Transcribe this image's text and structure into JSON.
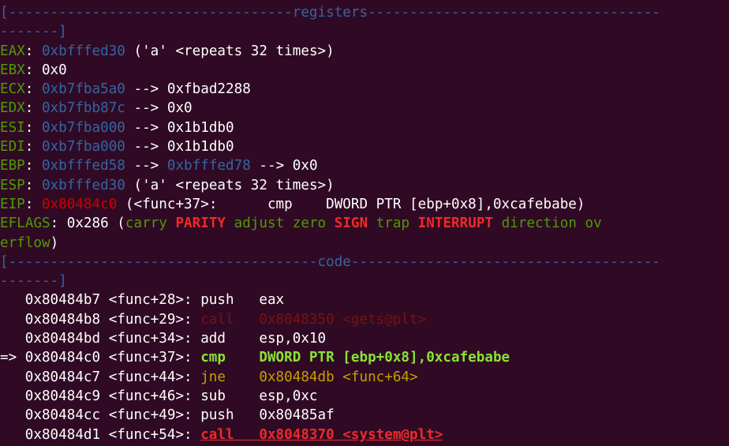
{
  "colors": {
    "background": "#300a24",
    "default": "#ffffff",
    "green": "#4e9a06",
    "blue": "#3465a4",
    "red": "#cc0000",
    "yellow": "#c4a000",
    "bright_green": "#8ae234",
    "bright_red": "#ef2929"
  },
  "lines": [
    [
      {
        "t": "[----------------------------------",
        "c": "blue"
      },
      {
        "t": "registers",
        "c": "blue"
      },
      {
        "t": "-----------------------------------",
        "c": "blue"
      }
    ],
    [
      {
        "t": "-------]",
        "c": "blue"
      }
    ],
    [
      {
        "t": "EAX",
        "c": "green"
      },
      {
        "t": ": ",
        "c": "default"
      },
      {
        "t": "0xbfffed30",
        "c": "blue"
      },
      {
        "t": " ('a' <repeats 32 times>)",
        "c": "default"
      }
    ],
    [
      {
        "t": "EBX",
        "c": "green"
      },
      {
        "t": ": 0x0",
        "c": "default"
      }
    ],
    [
      {
        "t": "ECX",
        "c": "green"
      },
      {
        "t": ": ",
        "c": "default"
      },
      {
        "t": "0xb7fba5a0",
        "c": "blue"
      },
      {
        "t": " --> 0xfbad2288",
        "c": "default"
      }
    ],
    [
      {
        "t": "EDX",
        "c": "green"
      },
      {
        "t": ": ",
        "c": "default"
      },
      {
        "t": "0xb7fbb87c",
        "c": "blue"
      },
      {
        "t": " --> 0x0",
        "c": "default"
      }
    ],
    [
      {
        "t": "ESI",
        "c": "green"
      },
      {
        "t": ": ",
        "c": "default"
      },
      {
        "t": "0xb7fba000",
        "c": "blue"
      },
      {
        "t": " --> 0x1b1db0",
        "c": "default"
      }
    ],
    [
      {
        "t": "EDI",
        "c": "green"
      },
      {
        "t": ": ",
        "c": "default"
      },
      {
        "t": "0xb7fba000",
        "c": "blue"
      },
      {
        "t": " --> 0x1b1db0",
        "c": "default"
      }
    ],
    [
      {
        "t": "EBP",
        "c": "green"
      },
      {
        "t": ": ",
        "c": "default"
      },
      {
        "t": "0xbfffed58",
        "c": "blue"
      },
      {
        "t": " --> ",
        "c": "default"
      },
      {
        "t": "0xbfffed78",
        "c": "blue"
      },
      {
        "t": " --> 0x0",
        "c": "default"
      }
    ],
    [
      {
        "t": "ESP",
        "c": "green"
      },
      {
        "t": ": ",
        "c": "default"
      },
      {
        "t": "0xbfffed30",
        "c": "blue"
      },
      {
        "t": " ('a' <repeats 32 times>)",
        "c": "default"
      }
    ],
    [
      {
        "t": "EIP",
        "c": "green"
      },
      {
        "t": ": ",
        "c": "default"
      },
      {
        "t": "0x80484c0",
        "c": "red"
      },
      {
        "t": " (<func+37>:\tcmp    DWORD PTR [ebp+0x8],0xcafebabe)",
        "c": "default"
      }
    ],
    [
      {
        "t": "EFLAGS",
        "c": "green"
      },
      {
        "t": ": 0x286 (",
        "c": "default"
      },
      {
        "t": "carry ",
        "c": "green"
      },
      {
        "t": "PARITY",
        "c": "bright_red",
        "b": true
      },
      {
        "t": " adjust zero ",
        "c": "green"
      },
      {
        "t": "SIGN",
        "c": "bright_red",
        "b": true
      },
      {
        "t": " trap ",
        "c": "green"
      },
      {
        "t": "INTERRUPT",
        "c": "bright_red",
        "b": true
      },
      {
        "t": " direction ov",
        "c": "green"
      }
    ],
    [
      {
        "t": "erflow",
        "c": "green"
      },
      {
        "t": ")",
        "c": "default"
      }
    ],
    [
      {
        "t": "[-------------------------------------",
        "c": "blue"
      },
      {
        "t": "code",
        "c": "blue"
      },
      {
        "t": "-------------------------------------",
        "c": "blue"
      }
    ],
    [
      {
        "t": "-------]",
        "c": "blue"
      }
    ],
    [
      {
        "t": "   0x80484b7 <func+28>:\tpush   eax",
        "c": "default"
      }
    ],
    [
      {
        "t": "   0x80484b8 <func+29>:\t",
        "c": "default"
      },
      {
        "t": "call   0x8048350 <gets@plt>",
        "c": "dim_red"
      }
    ],
    [
      {
        "t": "   0x80484bd <func+34>:\tadd    esp,0x10",
        "c": "default"
      }
    ],
    [
      {
        "t": "=> 0x80484c0 <func+37>:\t",
        "c": "default"
      },
      {
        "t": "cmp    DWORD PTR [ebp+0x8],0xcafebabe",
        "c": "bright_green",
        "b": true
      }
    ],
    [
      {
        "t": "   0x80484c7 <func+44>:\t",
        "c": "default"
      },
      {
        "t": "jne    0x80484db <func+64>",
        "c": "yellow"
      }
    ],
    [
      {
        "t": "   0x80484c9 <func+46>:\tsub    esp,0xc",
        "c": "default"
      }
    ],
    [
      {
        "t": "   0x80484cc <func+49>:\tpush   0x80485af",
        "c": "default"
      }
    ],
    [
      {
        "t": "   0x80484d1 <func+54>:\t",
        "c": "default"
      },
      {
        "t": "call   0x8048370 <system@plt>",
        "c": "bright_red",
        "b": true,
        "u": true
      }
    ]
  ]
}
